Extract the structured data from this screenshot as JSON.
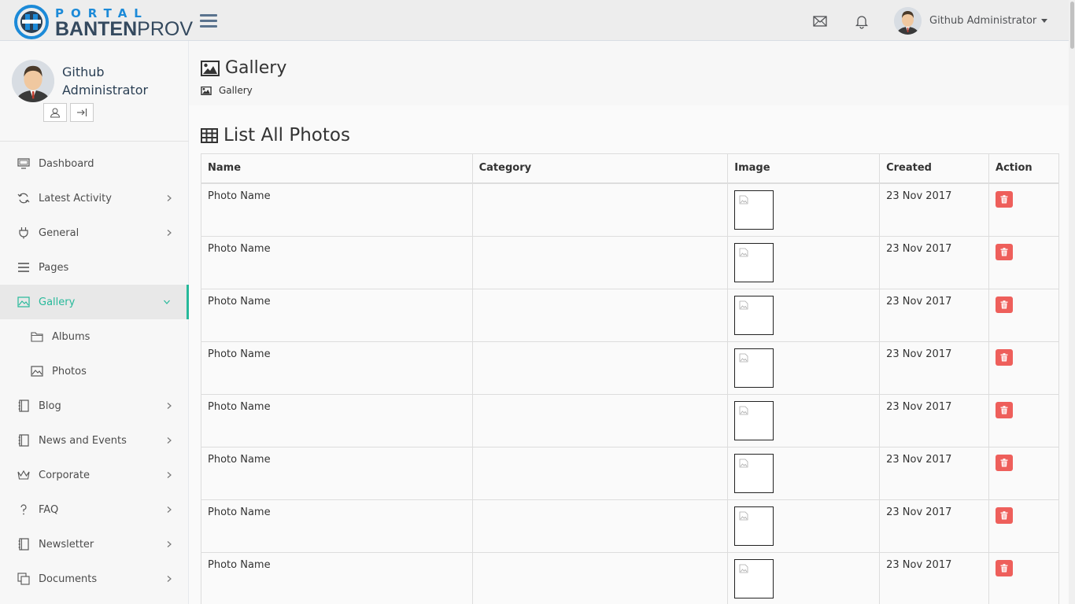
{
  "brand": {
    "line1": "PORTAL",
    "line2_bold": "BANTEN",
    "line2_light": "PROV"
  },
  "topbar": {
    "user_name": "Github Administrator",
    "icons": [
      "envelope-icon",
      "bell-icon"
    ]
  },
  "profile": {
    "name": "Github Administrator"
  },
  "sidebar": {
    "items": [
      {
        "label": "Dashboard",
        "icon": "monitor-icon",
        "has_children": false
      },
      {
        "label": "Latest Activity",
        "icon": "refresh-icon",
        "has_children": true
      },
      {
        "label": "General",
        "icon": "plug-icon",
        "has_children": true
      },
      {
        "label": "Pages",
        "icon": "list-icon",
        "has_children": false
      },
      {
        "label": "Gallery",
        "icon": "image-icon",
        "has_children": true,
        "active": true
      },
      {
        "label": "Albums",
        "icon": "folder-icon",
        "sub": true
      },
      {
        "label": "Photos",
        "icon": "image-icon",
        "sub": true
      },
      {
        "label": "Blog",
        "icon": "notebook-icon",
        "has_children": true
      },
      {
        "label": "News and Events",
        "icon": "notebook-icon",
        "has_children": true
      },
      {
        "label": "Corporate",
        "icon": "crown-icon",
        "has_children": true
      },
      {
        "label": "FAQ",
        "icon": "question-icon",
        "has_children": true
      },
      {
        "label": "Newsletter",
        "icon": "notebook-icon",
        "has_children": true
      },
      {
        "label": "Documents",
        "icon": "documents-icon",
        "has_children": true
      }
    ]
  },
  "page": {
    "title": "Gallery",
    "breadcrumb": "Gallery",
    "section_title": "List All Photos"
  },
  "table": {
    "headers": [
      "Name",
      "Category",
      "Image",
      "Created",
      "Action"
    ],
    "rows": [
      {
        "name": "Photo Name",
        "category": "",
        "created": "23 Nov 2017"
      },
      {
        "name": "Photo Name",
        "category": "",
        "created": "23 Nov 2017"
      },
      {
        "name": "Photo Name",
        "category": "",
        "created": "23 Nov 2017"
      },
      {
        "name": "Photo Name",
        "category": "",
        "created": "23 Nov 2017"
      },
      {
        "name": "Photo Name",
        "category": "",
        "created": "23 Nov 2017"
      },
      {
        "name": "Photo Name",
        "category": "",
        "created": "23 Nov 2017"
      },
      {
        "name": "Photo Name",
        "category": "",
        "created": "23 Nov 2017"
      },
      {
        "name": "Photo Name",
        "category": "",
        "created": "23 Nov 2017"
      }
    ]
  },
  "colors": {
    "accent": "#26b99a",
    "danger": "#ee5f5b",
    "brand_blue": "#1c8ad8",
    "sidebar_text": "#4c4c4c"
  }
}
